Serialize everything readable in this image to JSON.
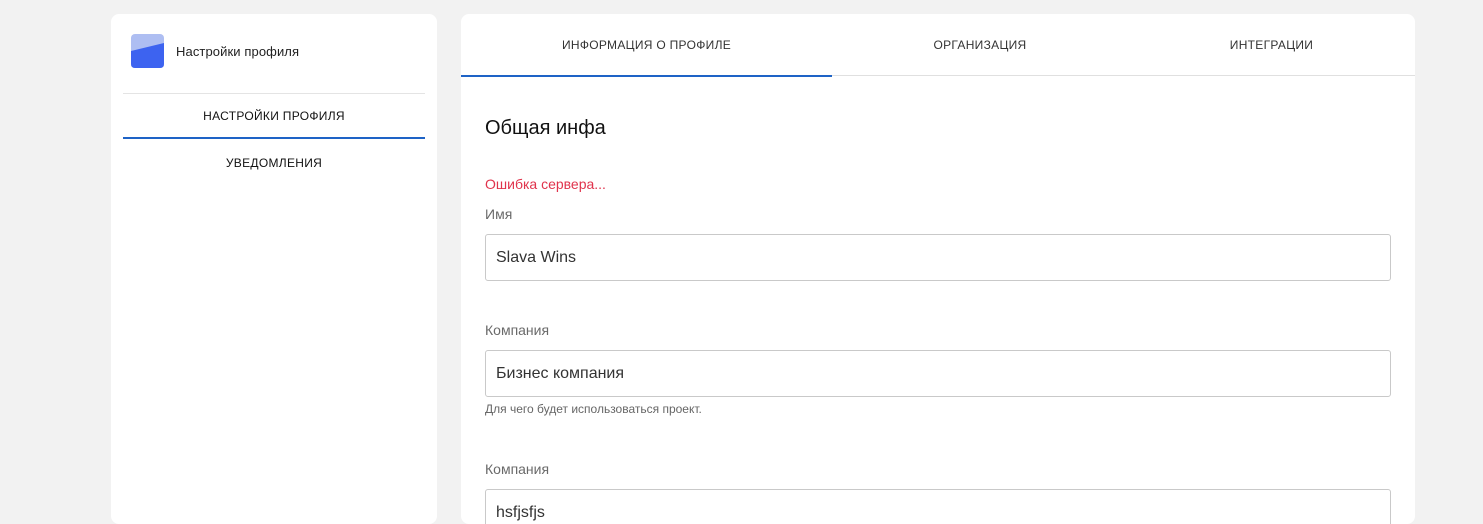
{
  "sidebar": {
    "title": "Настройки профиля",
    "items": [
      {
        "label": "НАСТРОЙКИ ПРОФИЛЯ",
        "active": true
      },
      {
        "label": "УВЕДОМЛЕНИЯ",
        "active": false
      }
    ]
  },
  "tabs": [
    {
      "label": "ИНФОРМАЦИЯ О ПРОФИЛЕ",
      "active": true
    },
    {
      "label": "ОРГАНИЗАЦИЯ",
      "active": false
    },
    {
      "label": "ИНТЕГРАЦИИ",
      "active": false
    }
  ],
  "form": {
    "section_title": "Общая инфа",
    "error": "Ошибка сервера...",
    "fields": [
      {
        "label": "Имя",
        "value": "Slava Wins"
      },
      {
        "label": "Компания",
        "value": "Бизнес компания",
        "helper": "Для чего будет использоваться проект."
      },
      {
        "label": "Компания",
        "value": "hsfjsfjs"
      }
    ]
  },
  "colors": {
    "accent": "#1e63c6",
    "error": "#e0334c",
    "logo_light": "#aebef2",
    "logo_dark": "#3d63f0"
  },
  "icons": {
    "logo": "app-logo-icon"
  }
}
